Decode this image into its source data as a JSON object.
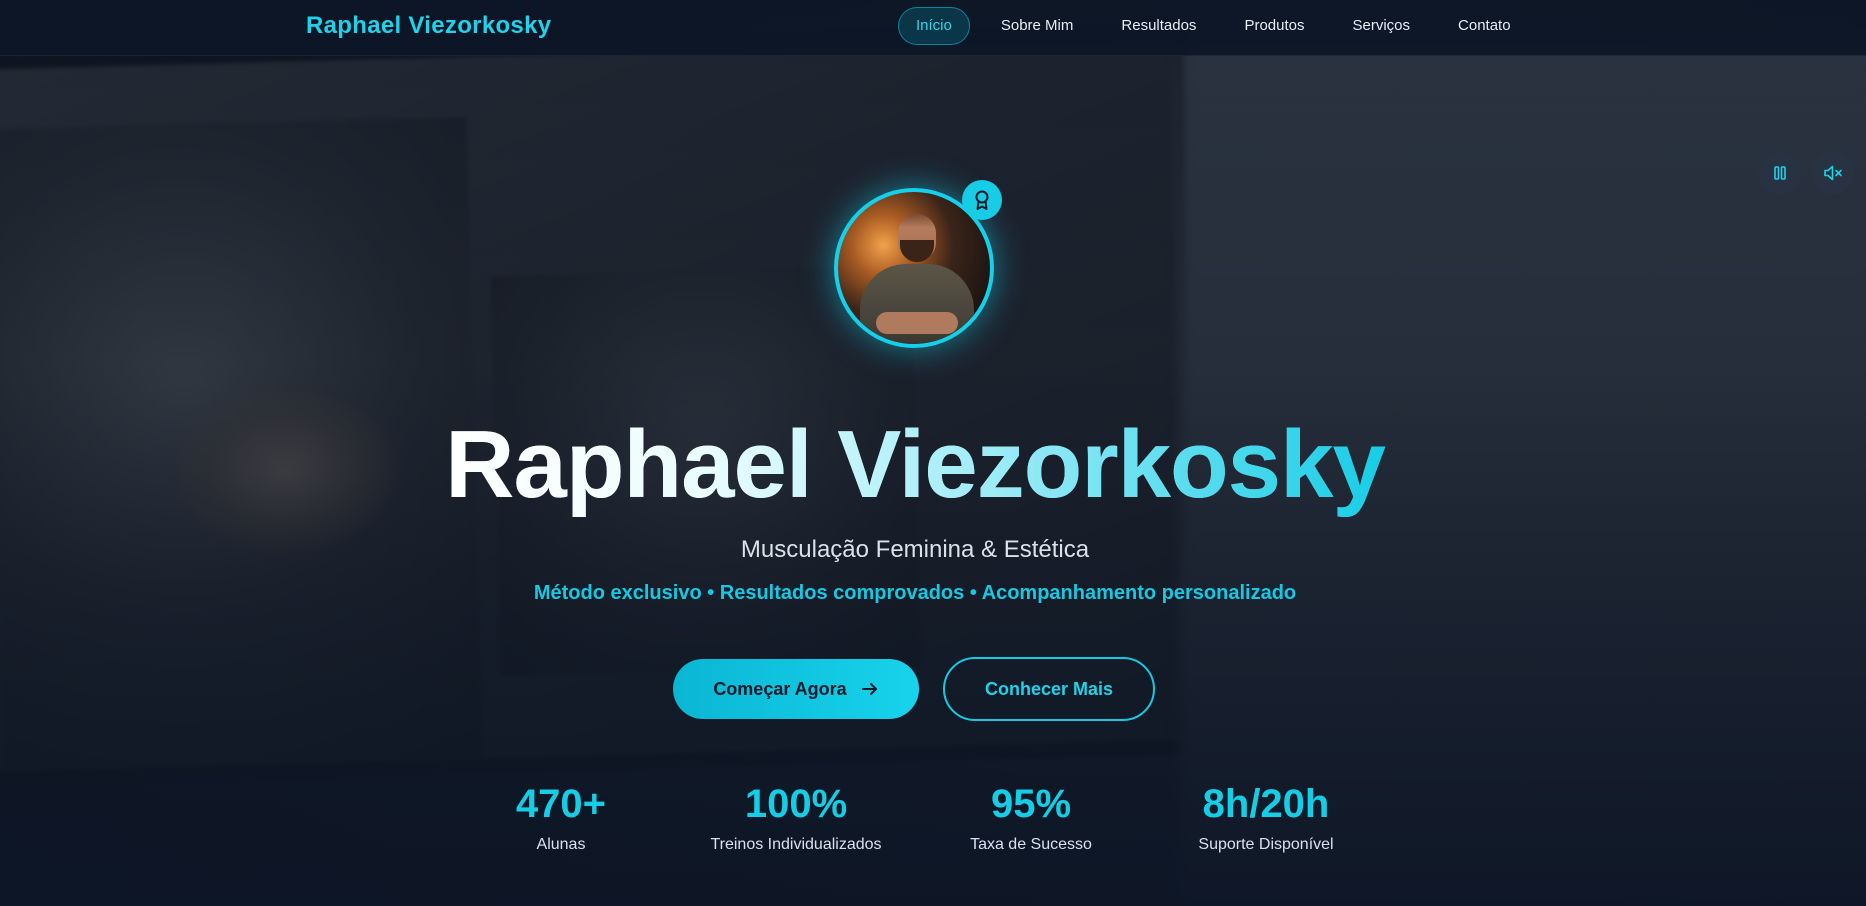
{
  "brand": "Raphael Viezorkosky",
  "nav": {
    "items": [
      {
        "label": "Início",
        "active": true
      },
      {
        "label": "Sobre Mim",
        "active": false
      },
      {
        "label": "Resultados",
        "active": false
      },
      {
        "label": "Produtos",
        "active": false
      },
      {
        "label": "Serviços",
        "active": false
      },
      {
        "label": "Contato",
        "active": false
      }
    ]
  },
  "media_controls": {
    "pause_icon": "pause-icon",
    "mute_icon": "volume-mute-icon"
  },
  "hero": {
    "title": "Raphael Viezorkosky",
    "subtitle": "Musculação Feminina & Estética",
    "tagline": "Método exclusivo • Resultados comprovados • Acompanhamento personalizado",
    "badge_icon": "award-icon",
    "cta_primary": "Começar Agora",
    "cta_primary_icon": "arrow-right-icon",
    "cta_secondary": "Conhecer Mais"
  },
  "stats": [
    {
      "value": "470+",
      "label": "Alunas"
    },
    {
      "value": "100%",
      "label": "Treinos Individualizados"
    },
    {
      "value": "95%",
      "label": "Taxa de Sucesso"
    },
    {
      "value": "8h/20h",
      "label": "Suporte Disponível"
    }
  ],
  "colors": {
    "accent": "#16cde6",
    "background": "#0d1626",
    "nav_active_bg": "#0f3a4a"
  }
}
